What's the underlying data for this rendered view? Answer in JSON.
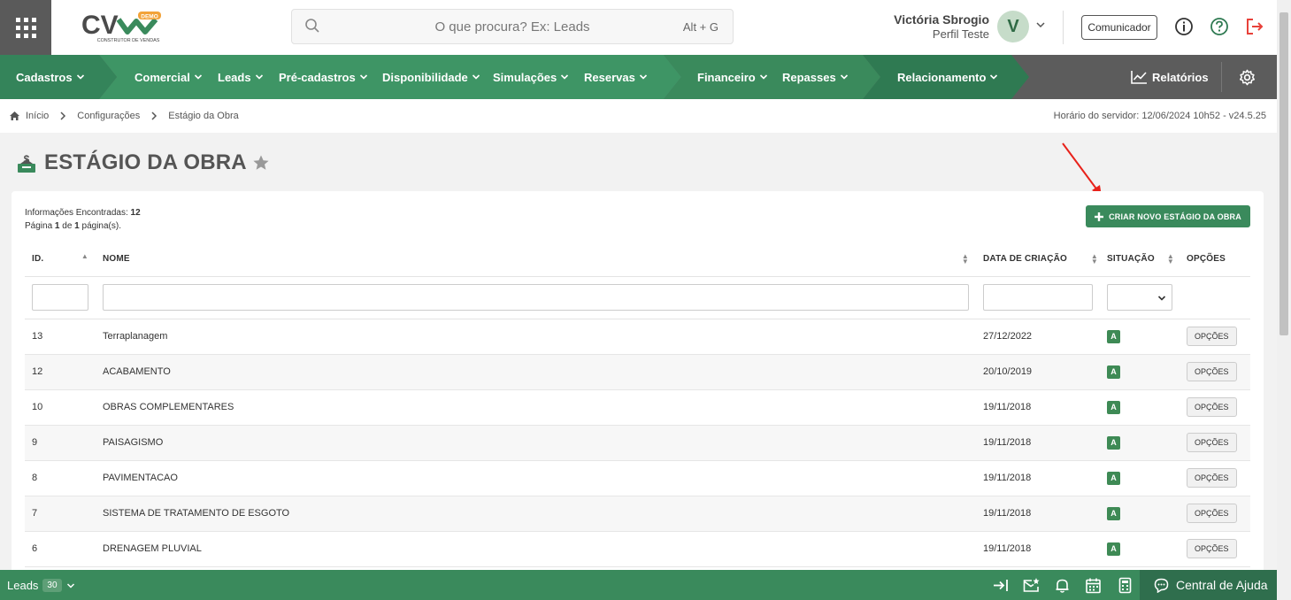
{
  "header": {
    "logo_text": "CV",
    "logo_badge": "DEMO",
    "logo_subtitle": "CONSTRUTOR DE VENDAS",
    "search_placeholder": "O que procura? Ex: Leads",
    "search_shortcut": "Alt + G",
    "user_name": "Victória Sbrogio",
    "user_profile": "Perfil Teste",
    "avatar_initial": "V",
    "communicator_label": "Comunicador"
  },
  "nav": {
    "items": [
      {
        "label": "Cadastros"
      },
      {
        "label": "Comercial"
      },
      {
        "label": "Leads"
      },
      {
        "label": "Pré-cadastros"
      },
      {
        "label": "Disponibilidade"
      },
      {
        "label": "Simulações"
      },
      {
        "label": "Reservas"
      },
      {
        "label": "Financeiro"
      },
      {
        "label": "Repasses"
      },
      {
        "label": "Relacionamento"
      }
    ],
    "reports_label": "Relatórios"
  },
  "breadcrumb": {
    "items": [
      "Início",
      "Configurações",
      "Estágio da Obra"
    ],
    "server_time": "Horário do servidor: 12/06/2024 10h52 - v24.5.25"
  },
  "page": {
    "title": "ESTÁGIO DA OBRA",
    "info_found_label": "Informações Encontradas:",
    "info_found_value": "12",
    "page_label": "Página",
    "page_current": "1",
    "page_of": "de",
    "page_total": "1",
    "page_suffix": "página(s).",
    "create_button": "CRIAR NOVO ESTÁGIO DA OBRA"
  },
  "table": {
    "headers": [
      "ID.",
      "NOME",
      "DATA DE CRIAÇÃO",
      "SITUAÇÃO",
      "OPÇÕES"
    ],
    "rows": [
      {
        "id": "13",
        "name": "Terraplanagem",
        "date": "27/12/2022",
        "status": "A",
        "options": "OPÇÕES"
      },
      {
        "id": "12",
        "name": "ACABAMENTO",
        "date": "20/10/2019",
        "status": "A",
        "options": "OPÇÕES"
      },
      {
        "id": "10",
        "name": "OBRAS COMPLEMENTARES",
        "date": "19/11/2018",
        "status": "A",
        "options": "OPÇÕES"
      },
      {
        "id": "9",
        "name": "PAISAGISMO",
        "date": "19/11/2018",
        "status": "A",
        "options": "OPÇÕES"
      },
      {
        "id": "8",
        "name": "PAVIMENTACAO",
        "date": "19/11/2018",
        "status": "A",
        "options": "OPÇÕES"
      },
      {
        "id": "7",
        "name": "SISTEMA DE TRATAMENTO DE ESGOTO",
        "date": "19/11/2018",
        "status": "A",
        "options": "OPÇÕES"
      },
      {
        "id": "6",
        "name": "DRENAGEM PLUVIAL",
        "date": "19/11/2018",
        "status": "A",
        "options": "OPÇÕES"
      }
    ]
  },
  "footer": {
    "leads_label": "Leads",
    "leads_count": "30",
    "help_label": "Central de Ajuda"
  },
  "colors": {
    "primary_green": "#3a8a5c",
    "nav_green": "#3e9565",
    "nav_gray": "#5c5c5c",
    "status_green": "#3e8a55",
    "logout_red": "#e8413a"
  },
  "icons": [
    "apps-grid-icon",
    "search-icon",
    "chevron-down-icon",
    "info-icon",
    "help-icon",
    "logout-icon",
    "chart-line-icon",
    "gear-icon",
    "home-icon",
    "chevron-right-icon",
    "page-title-icon",
    "star-icon",
    "plus-icon",
    "sort-icon",
    "login-icon",
    "mail-star-icon",
    "bell-icon",
    "calendar-icon",
    "calculator-icon",
    "chat-icon"
  ]
}
